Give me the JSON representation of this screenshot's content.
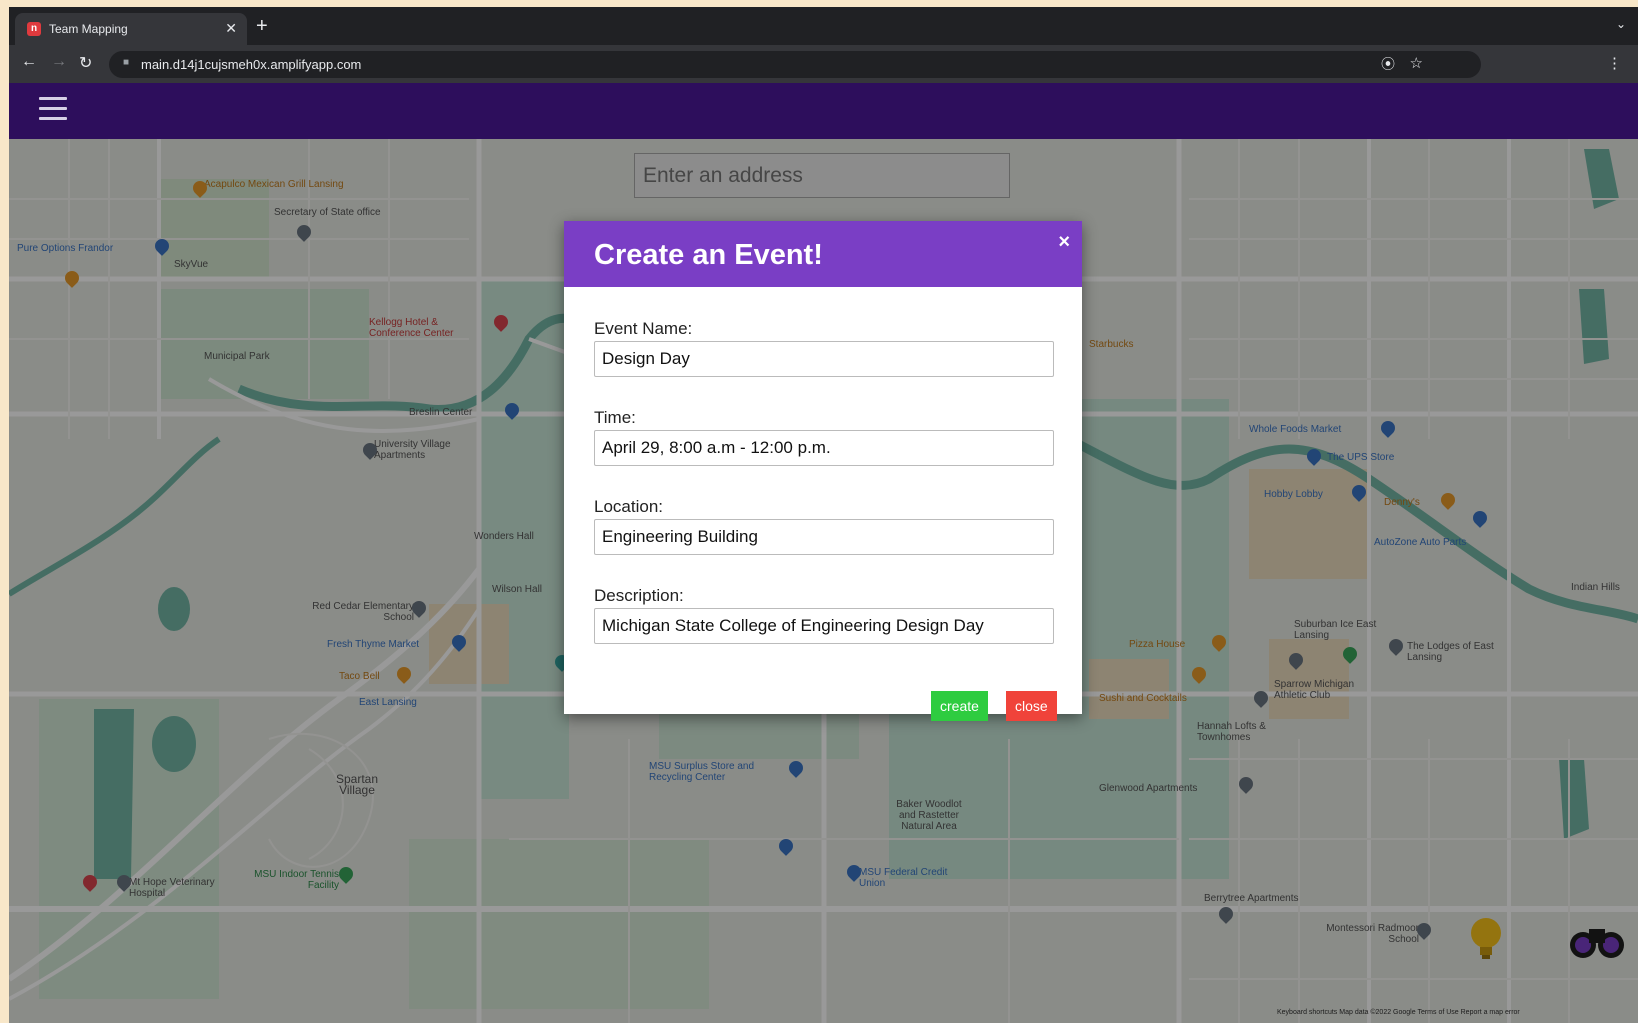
{
  "browser": {
    "tab_title": "Team Mapping",
    "tab_favicon_letter": "n",
    "url": "main.d14j1cujsmeh0x.amplifyapp.com",
    "icons": [
      "back-icon",
      "forward-icon",
      "reload-icon",
      "lock-icon",
      "location-pin-icon",
      "star-icon",
      "kebab-menu-icon",
      "new-tab-icon",
      "tab-close-icon",
      "tab-search-icon"
    ]
  },
  "app": {
    "header_color": "#2d0e5c",
    "menu_icon": "hamburger-icon"
  },
  "map": {
    "address_placeholder": "Enter an address",
    "pois": [
      "Acapulco Mexican Grill Lansing",
      "Secretary of State office",
      "Pure Options Frandor",
      "SkyVue",
      "Kellogg Hotel & Conference Center",
      "Municipal Park",
      "Breslin Center",
      "University Village Apartments",
      "Wonders Hall",
      "Wilson Hall",
      "Red Cedar Elementary School",
      "Fresh Thyme Market",
      "Taco Bell",
      "East Lansing",
      "Spartan Village",
      "MSU Surplus Store and Recycling Center",
      "Baker Woodlot and Rastetter Natural Area",
      "MSU Indoor Tennis Facility",
      "Mt Hope Veterinary Hospital",
      "MSU Federal Credit Union",
      "Whole Foods Market",
      "The UPS Store",
      "Hobby Lobby",
      "Denny's",
      "AutoZone Auto Parts",
      "Pizza House",
      "Suburban Ice East Lansing",
      "The Lodges of East Lansing",
      "Sparrow Michigan Athletic Club",
      "Hannah Lofts & Townhomes",
      "Glenwood Apartments",
      "Berrytree Apartments",
      "Montessori Radmoor School",
      "Starbucks",
      "Sushi and Cocktails",
      "Indian Hills"
    ],
    "footer_text": "Keyboard shortcuts   Map data ©2022 Google  Terms of Use   Report a map error",
    "pegman_icon": "pegman-lightbulb-icon",
    "binoculars_icon": "binoculars-icon"
  },
  "modal": {
    "title": "Create an Event!",
    "close_symbol": "×",
    "fields": [
      {
        "label": "Event Name:",
        "value": "Design Day"
      },
      {
        "label": "Time:",
        "value": "April 29, 8:00 a.m - 12:00 p.m."
      },
      {
        "label": "Location:",
        "value": "Engineering Building"
      },
      {
        "label": "Description:",
        "value": "Michigan State College of Engineering Design Day"
      }
    ],
    "create_label": "create",
    "close_label": "close",
    "header_color": "#7a3ec5",
    "create_color": "#2ecc40",
    "close_color": "#f0433a"
  }
}
